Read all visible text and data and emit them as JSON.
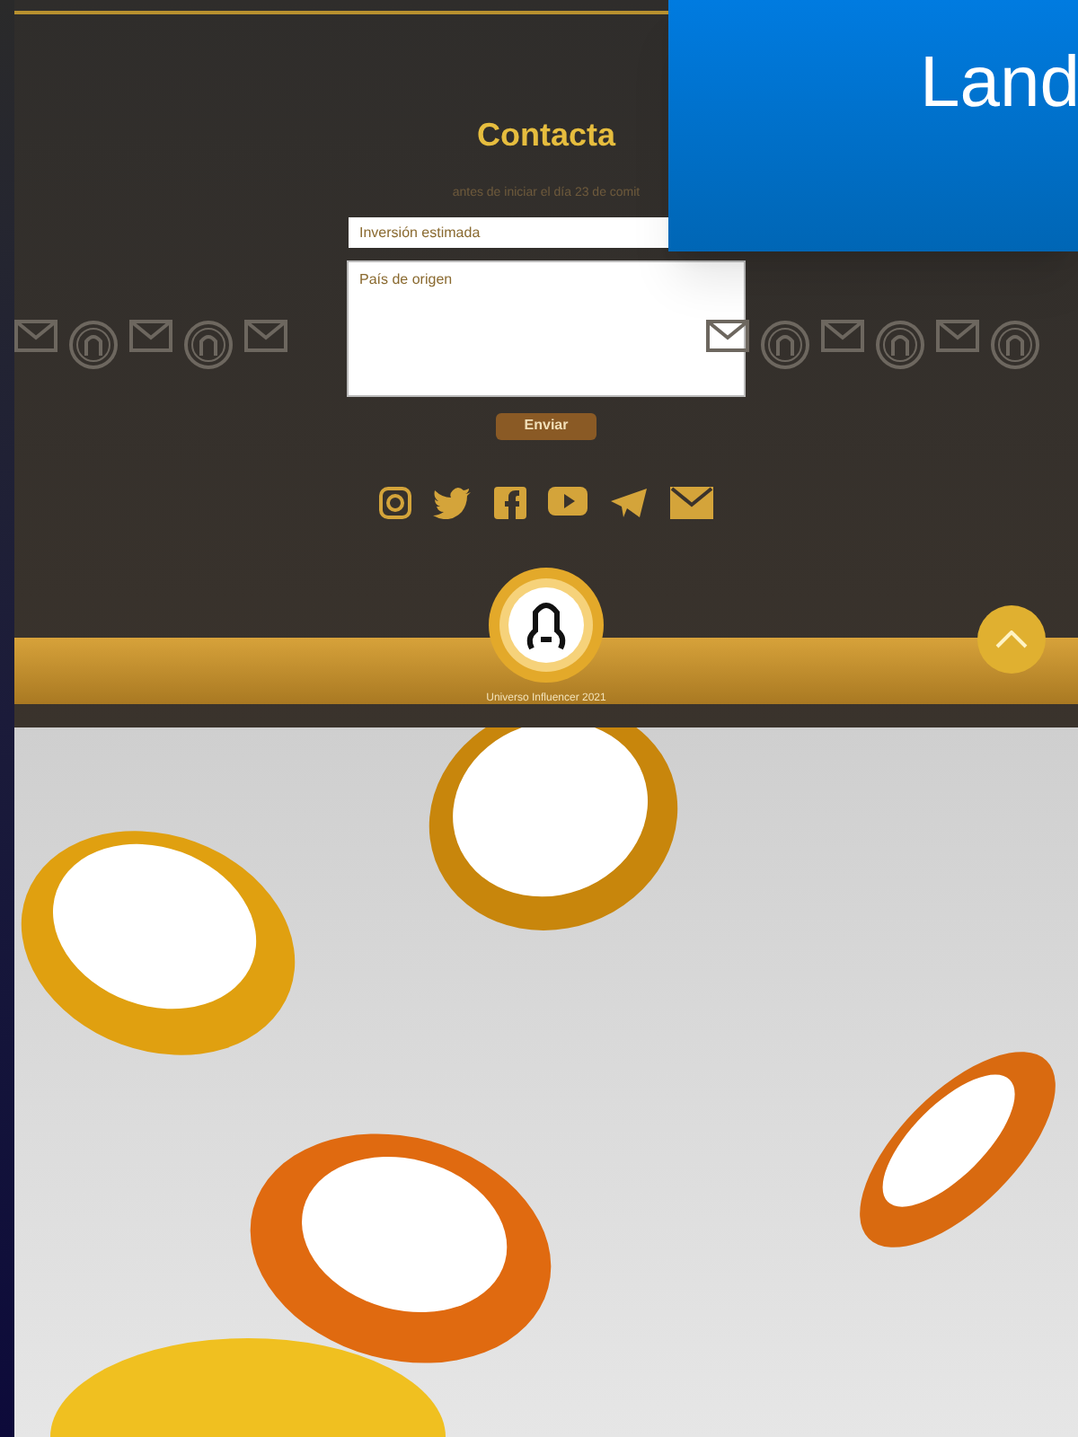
{
  "contact_section": {
    "title": "Contacta",
    "subtitle": "antes de iniciar el día 23 de comit",
    "fields": [
      {
        "placeholder": "Inversión estimada",
        "kind": "input"
      },
      {
        "placeholder": "País de origen",
        "kind": "textarea"
      }
    ],
    "submit_button": "Enviar",
    "footer_text": "Universo Influencer 2021"
  },
  "overlay_card": {
    "title": "Land"
  }
}
